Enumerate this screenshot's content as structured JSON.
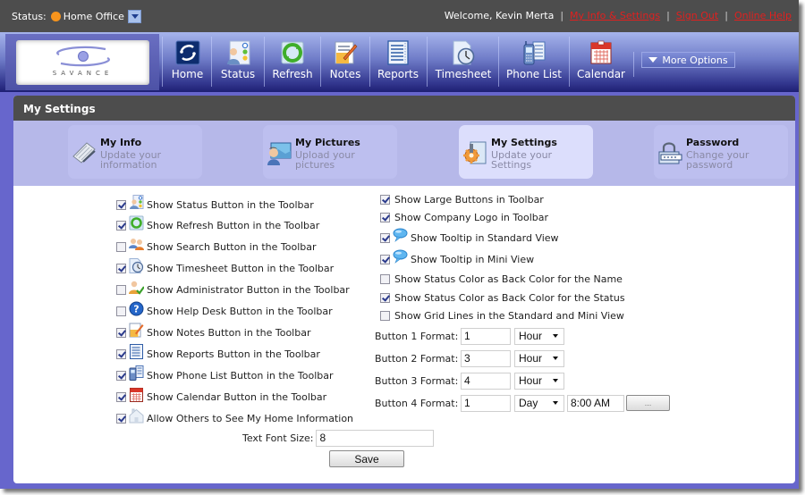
{
  "topbar": {
    "status_label": "Status:",
    "status_value": "Home Office",
    "status_color": "#f7941d",
    "welcome": "Welcome, Kevin Merta",
    "links": [
      "My Info & Settings",
      "Sign Out",
      "Online Help"
    ],
    "separator": "|"
  },
  "logo": {
    "brand": "SAVANCE"
  },
  "toolbar": {
    "buttons": [
      {
        "label": "Home",
        "icon": "home-icon"
      },
      {
        "label": "Status",
        "icon": "status-icon"
      },
      {
        "label": "Refresh",
        "icon": "refresh-icon"
      },
      {
        "label": "Notes",
        "icon": "notes-icon"
      },
      {
        "label": "Reports",
        "icon": "reports-icon"
      },
      {
        "label": "Timesheet",
        "icon": "timesheet-icon"
      },
      {
        "label": "Phone List",
        "icon": "phone-list-icon"
      },
      {
        "label": "Calendar",
        "icon": "calendar-icon"
      }
    ],
    "more_options": "More Options"
  },
  "panel": {
    "title": "My Settings",
    "tabs": [
      {
        "title": "My Info",
        "subtitle": "Update your information",
        "active": false
      },
      {
        "title": "My Pictures",
        "subtitle": "Upload your pictures",
        "active": false
      },
      {
        "title": "My Settings",
        "subtitle": "Update your Settings",
        "active": true
      },
      {
        "title": "Password",
        "subtitle": "Change your password",
        "active": false
      }
    ]
  },
  "settings": {
    "left_options": [
      {
        "label": "Show Status Button in the Toolbar",
        "checked": true,
        "icon": "status-icon"
      },
      {
        "label": "Show Refresh Button in the Toolbar",
        "checked": true,
        "icon": "refresh-icon"
      },
      {
        "label": "Show Search Button in the Toolbar",
        "checked": false,
        "icon": "search-people-icon"
      },
      {
        "label": "Show Timesheet Button in the Toolbar",
        "checked": true,
        "icon": "timesheet-icon"
      },
      {
        "label": "Show Administrator Button in the Toolbar",
        "checked": false,
        "icon": "administrator-icon"
      },
      {
        "label": "Show Help Desk Button in the Toolbar",
        "checked": false,
        "icon": "help-icon"
      },
      {
        "label": "Show Notes Button in the Toolbar",
        "checked": true,
        "icon": "notes-icon"
      },
      {
        "label": "Show Reports Button in the Toolbar",
        "checked": true,
        "icon": "reports-icon"
      },
      {
        "label": "Show Phone List Button in the Toolbar",
        "checked": true,
        "icon": "phone-list-icon"
      },
      {
        "label": "Show Calendar Button in the Toolbar",
        "checked": true,
        "icon": "calendar-icon"
      },
      {
        "label": "Allow Others to See My Home Information",
        "checked": true,
        "icon": "home-info-icon"
      }
    ],
    "right_options": [
      {
        "label": "Show Large Buttons in Toolbar",
        "checked": true,
        "icon": ""
      },
      {
        "label": "Show Company Logo in Toolbar",
        "checked": true,
        "icon": ""
      },
      {
        "label": "Show Tooltip in Standard View",
        "checked": true,
        "icon": "tooltip-icon"
      },
      {
        "label": "Show Tooltip in Mini View",
        "checked": true,
        "icon": "tooltip-icon"
      },
      {
        "label": "Show Status Color as Back Color for the Name",
        "checked": false,
        "icon": ""
      },
      {
        "label": "Show Status Color as Back Color for the Status",
        "checked": true,
        "icon": ""
      },
      {
        "label": "Show Grid Lines in the Standard and Mini View",
        "checked": false,
        "icon": ""
      }
    ],
    "formats": [
      {
        "label": "Button 1 Format:",
        "value": "1",
        "unit": "Hour"
      },
      {
        "label": "Button 2 Format:",
        "value": "3",
        "unit": "Hour"
      },
      {
        "label": "Button 3 Format:",
        "value": "4",
        "unit": "Hour"
      },
      {
        "label": "Button 4 Format:",
        "value": "1",
        "unit": "Day",
        "time": "8:00 AM",
        "picker_label": "..."
      }
    ],
    "font_size_label": "Text Font Size:",
    "font_size_value": "8",
    "save_label": "Save"
  }
}
